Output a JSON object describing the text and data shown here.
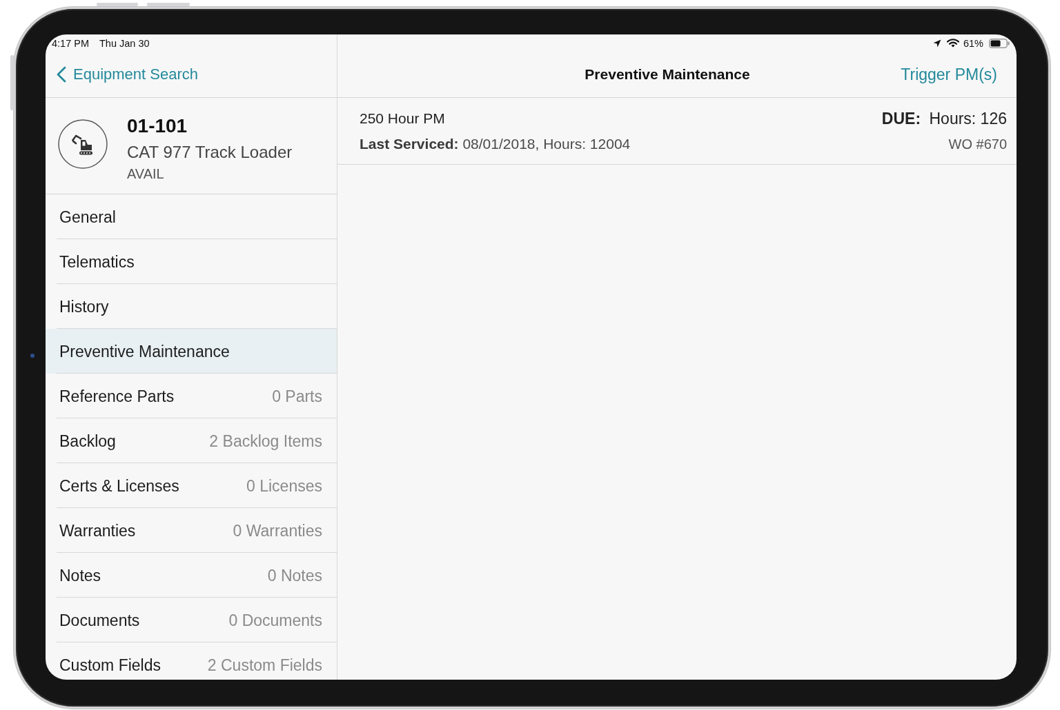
{
  "status_bar": {
    "time": "4:17 PM",
    "date": "Thu Jan 30",
    "battery": "61%"
  },
  "sidebar": {
    "back_label": "Equipment Search",
    "equipment": {
      "id": "01-101",
      "name": "CAT 977 Track Loader",
      "status": "AVAIL"
    },
    "items": [
      {
        "label": "General",
        "selected": false
      },
      {
        "label": "Telematics",
        "selected": false
      },
      {
        "label": "History",
        "selected": false
      },
      {
        "label": "Preventive Maintenance",
        "selected": true
      },
      {
        "label": "Reference Parts",
        "count": "0 Parts",
        "selected": false
      },
      {
        "label": "Backlog",
        "count": "2 Backlog Items",
        "selected": false
      },
      {
        "label": "Certs & Licenses",
        "count": "0 Licenses",
        "selected": false
      },
      {
        "label": "Warranties",
        "count": "0 Warranties",
        "selected": false
      },
      {
        "label": "Notes",
        "count": "0 Notes",
        "selected": false
      },
      {
        "label": "Documents",
        "count": "0 Documents",
        "selected": false
      },
      {
        "label": "Custom Fields",
        "count": "2 Custom Fields",
        "selected": false
      }
    ]
  },
  "detail": {
    "title": "Preventive Maintenance",
    "action": "Trigger PM(s)",
    "pm_items": [
      {
        "name": "250 Hour PM",
        "last_serviced": "**Last Serviced:** 08/01/2018, Hours: 12004",
        "due": "**DUE:** Hours: 126",
        "work_order": "WO #670"
      }
    ]
  }
}
